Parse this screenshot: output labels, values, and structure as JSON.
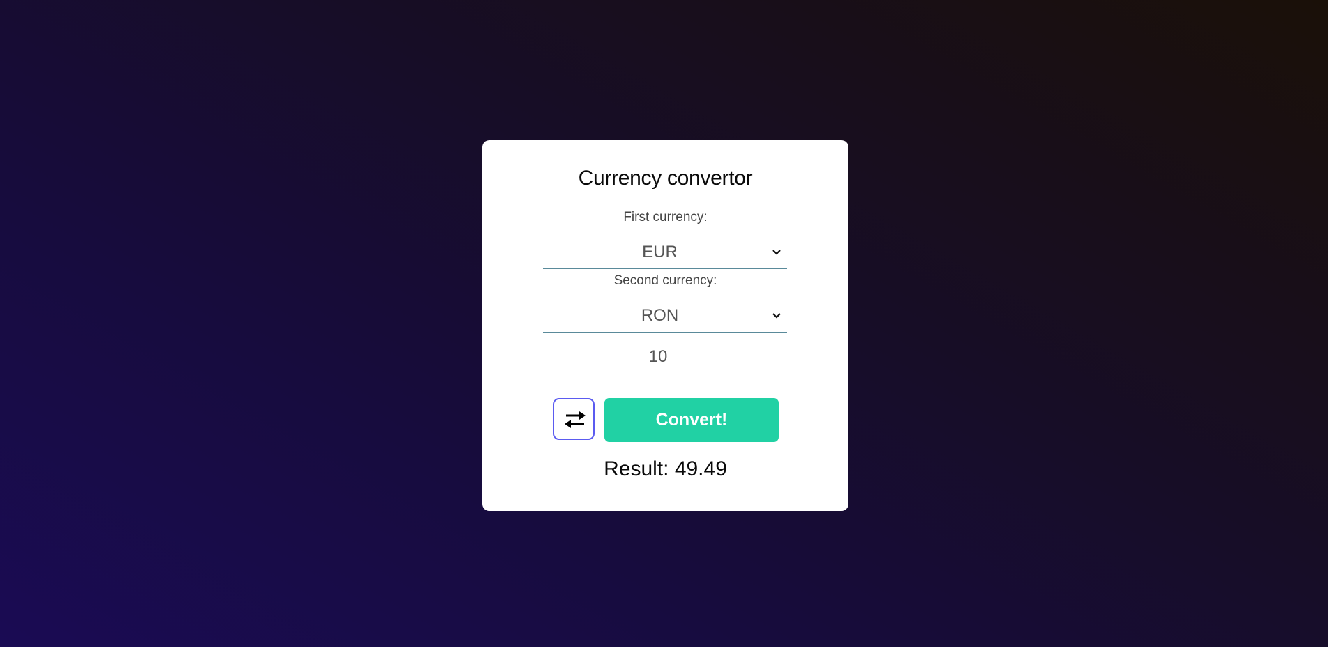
{
  "colors": {
    "accent": "#21d1a4",
    "swap_border": "#5b5bf0",
    "card_bg": "#ffffff"
  },
  "converter": {
    "title": "Currency convertor",
    "first_label": "First currency:",
    "first_value": "EUR",
    "second_label": "Second currency:",
    "second_value": "RON",
    "amount": "10",
    "swap_icon": "swap-arrows-icon",
    "convert_label": "Convert!",
    "result": "Result: 49.49"
  }
}
